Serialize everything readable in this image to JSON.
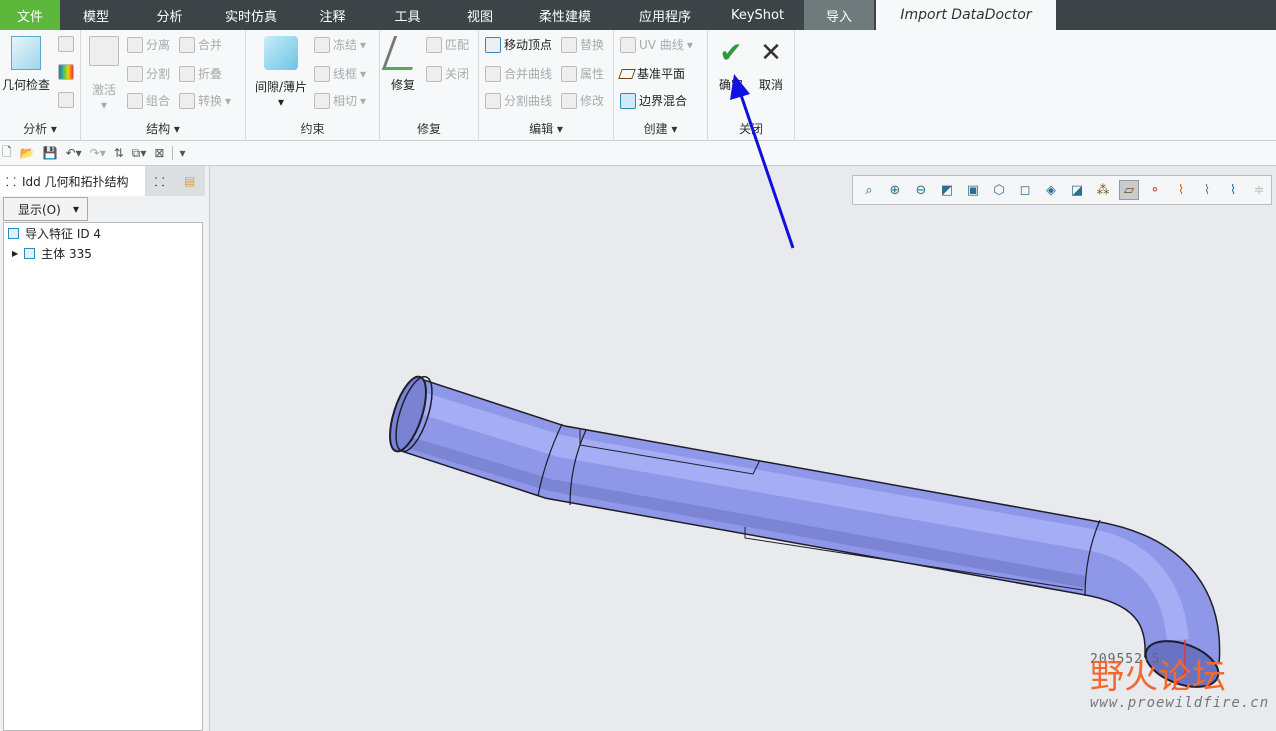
{
  "tabs": [
    "文件",
    "模型",
    "分析",
    "实时仿真",
    "注释",
    "工具",
    "视图",
    "柔性建模",
    "应用程序",
    "KeyShot",
    "导入",
    "Import DataDoctor"
  ],
  "ribbon": {
    "analysis": {
      "label": "分析",
      "big": "几何检查"
    },
    "structure": {
      "label": "结构",
      "big": "激活",
      "items": [
        "分离",
        "合并",
        "分割",
        "折叠",
        "组合",
        "转换"
      ]
    },
    "constraint": {
      "label": "约束",
      "big": "间隙/薄片",
      "items": [
        "冻结",
        "线框",
        "相切"
      ]
    },
    "repair": {
      "label": "修复",
      "big": "修复",
      "items": [
        "匹配",
        "关闭"
      ]
    },
    "edit": {
      "label": "编辑",
      "items": [
        "移动顶点",
        "替换",
        "合并曲线",
        "属性",
        "分割曲线",
        "修改"
      ]
    },
    "create": {
      "label": "创建",
      "items": [
        "UV 曲线",
        "基准平面",
        "边界混合"
      ]
    },
    "close": {
      "label": "关闭",
      "ok": "确定",
      "cancel": "取消"
    }
  },
  "left": {
    "tab": "Idd 几何和拓扑结构",
    "show": "显示(O)",
    "tree": [
      "导入特征 ID 4",
      "主体 335"
    ]
  },
  "watermark": {
    "id": "209552-5",
    "name": "野火论坛",
    "url": "www.proewildfire.cn"
  },
  "colors": {
    "accent": "#5cb83a",
    "pipe": "#8f98e8",
    "arrow": "#1010e0"
  }
}
